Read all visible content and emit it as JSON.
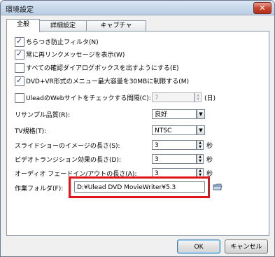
{
  "window": {
    "title": "環境設定",
    "close_label": "✕"
  },
  "tabs": [
    {
      "label": "全般",
      "active": true
    },
    {
      "label": "詳細設定",
      "active": false
    },
    {
      "label": "キャプチャ",
      "active": false
    }
  ],
  "options": {
    "flicker_filter": {
      "label": "ちらつき防止フィルタ(N)",
      "checked": true
    },
    "relink_message": {
      "label": "常に再リンクメッセージを表示(W)",
      "checked": true
    },
    "confirm_dialogs": {
      "label": "すべての確認ダイアログボックスを出すようにする(E)",
      "checked": false
    },
    "dvd_vr_limit": {
      "label": "DVD+VR形式のメニュー最大容量を30MBに制限する(M)",
      "checked": true
    },
    "ulead_web_check": {
      "label": "UleadのWebサイトをチェックする間隔(C):",
      "checked": false,
      "value": "7",
      "unit": "(日)"
    }
  },
  "resample": {
    "label": "リサンプル品質(R):",
    "value": "良好"
  },
  "tv_standard": {
    "label": "TV規格(T):",
    "value": "NTSC"
  },
  "slideshow_length": {
    "label": "スライドショーのイメージの長さ(S):",
    "value": "3",
    "unit": "秒"
  },
  "video_transition": {
    "label": "ビデオトランジション効果の長さ(D):",
    "value": "3",
    "unit": "秒"
  },
  "audio_fade": {
    "label": "オーディオ フェードイン/アウトの長さ(A):",
    "value": "3",
    "unit": "秒"
  },
  "work_folder": {
    "label": "作業フォルダ(F):",
    "value": "D:¥Ulead DVD MovieWriter¥5.3"
  },
  "buttons": {
    "ok": "OK",
    "cancel": "キャンセル"
  },
  "colors": {
    "highlight": "#e0141b",
    "checkmark": "#1b3a8f"
  }
}
